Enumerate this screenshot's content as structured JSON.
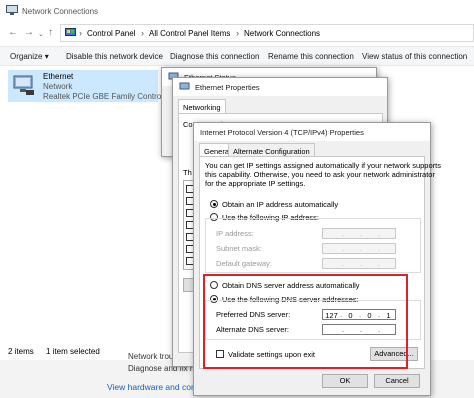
{
  "window": {
    "title": "Network Connections"
  },
  "address_bar": {
    "segments": [
      "Control Panel",
      "All Control Panel Items",
      "Network Connections"
    ]
  },
  "command_bar": {
    "organize": "Organize",
    "disable": "Disable this network device",
    "diagnose": "Diagnose this connection",
    "rename": "Rename this connection",
    "view_status": "View status of this connection"
  },
  "ethernet": {
    "name": "Ethernet",
    "status": "Network",
    "adapter": "Realtek PCIe GBE Family Controller"
  },
  "status_bar": {
    "items": "2 items",
    "selected": "1 item selected"
  },
  "lower_pane": {
    "line1": "Network troubles",
    "line2": "Diagnose and fix n",
    "link": "View hardware and conn"
  },
  "status_dialog": {
    "title": "Ethernet Status"
  },
  "props_dialog": {
    "title": "Ethernet Properties",
    "tab": "Networking",
    "conn_label": "Connect using:",
    "this_label": "Th"
  },
  "tcp_dialog": {
    "title": "Internet Protocol Version 4 (TCP/IPv4) Properties",
    "tabs": [
      "General",
      "Alternate Configuration"
    ],
    "description": [
      "You can get IP settings assigned automatically if your network supports",
      "this capability. Otherwise, you need to ask your network administrator",
      "for the appropriate IP settings."
    ],
    "obtain_ip": "Obtain an IP address automatically",
    "use_ip": "Use the following IP address:",
    "ip_address": "IP address:",
    "subnet": "Subnet mask:",
    "gateway": "Default gateway:",
    "obtain_dns": "Obtain DNS server address automatically",
    "use_dns": "Use the following DNS server addresses:",
    "preferred_dns": "Preferred DNS server:",
    "alternate_dns": "Alternate DNS server:",
    "preferred_dns_value": [
      "127",
      "0",
      "0",
      "1"
    ],
    "validate": "Validate settings upon exit",
    "advanced": "Advanced...",
    "ok": "OK",
    "cancel": "Cancel"
  },
  "colors": {
    "highlight": "#d9232a",
    "selection": "#cce8ff"
  }
}
